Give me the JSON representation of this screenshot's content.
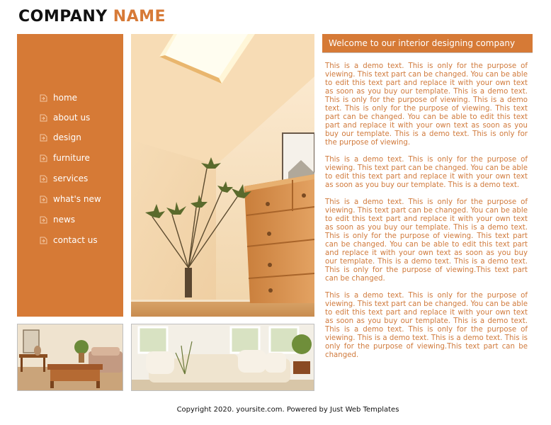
{
  "logo": {
    "word1": "COMPANY",
    "word2": "NAME"
  },
  "nav": {
    "items": [
      {
        "label": "home"
      },
      {
        "label": "about us"
      },
      {
        "label": "design"
      },
      {
        "label": "furniture"
      },
      {
        "label": "services"
      },
      {
        "label": "what's new"
      },
      {
        "label": "news"
      },
      {
        "label": "contact us"
      }
    ],
    "icon": "document-arrow-icon"
  },
  "welcome": {
    "title": "Welcome to our interior designing company"
  },
  "content": {
    "paragraphs": [
      "This is a demo text. This is only for the purpose of viewing. This text part can be changed. You can be able to edit this text part and replace it with your own text as soon as you buy our template. This is a demo text. This is only for the purpose of viewing. This is a demo text. This is only for the purpose of viewing. This text part can be changed. You can be able to edit this text part and replace it with your own text as soon as you buy our template. This is a demo text. This is only for the purpose of viewing.",
      "This is a demo text. This is only for the purpose of viewing. This text part can be changed. You can be able to edit this text part and replace it with your own text as soon as you buy our template. This is a demo text.",
      "This is a demo text. This is only for the purpose of viewing. This text part can be changed. You can be able to edit this text part and replace it with your own text as soon as you buy our template. This is a demo text. This is only for the purpose of viewing. This text part can be changed. You can be able to edit this text part and replace it with your own text as soon as you buy our template. This is a demo text. This is a demo text. This is only for the purpose of viewing.This text part can be changed.",
      "This is a demo text. This is only for the purpose of viewing. This text part can be changed. You can be able to edit this text part and replace it with your own text as soon as you buy our template. This is a demo text. This is a demo text. This is only for the purpose of viewing. This is a demo text. This is a demo text. This is only for the purpose of viewing.This text part can be changed."
    ]
  },
  "footer": {
    "text": "Copyright 2020. yoursite.com. Powered by Just Web Templates"
  },
  "colors": {
    "accent": "#d67a36",
    "text": "#d07a3c"
  }
}
